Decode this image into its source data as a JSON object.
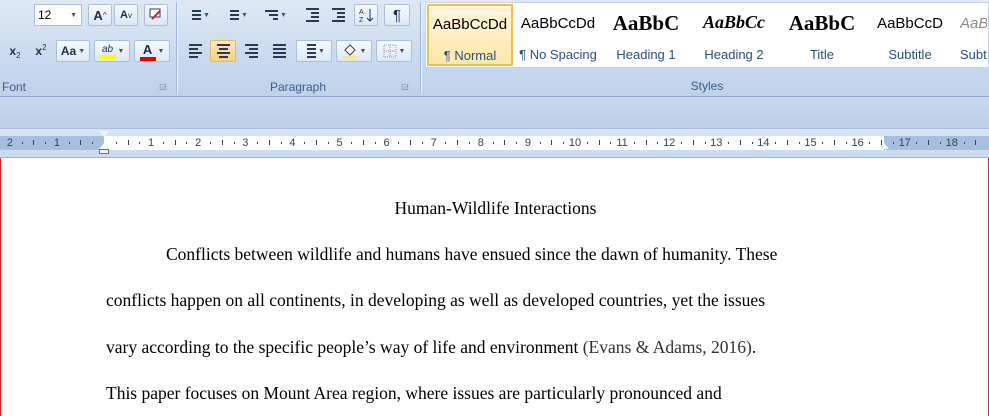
{
  "font_group": {
    "label": "Font",
    "font_size": "12",
    "grow_font": "A",
    "shrink_font": "A",
    "subscript": "x",
    "superscript": "x",
    "change_case": "Aa",
    "highlight_text": "ab",
    "font_color_letter": "A",
    "highlight_color": "#ffff00",
    "font_color": "#e00000"
  },
  "paragraph_group": {
    "label": "Paragraph",
    "show_marks": "¶"
  },
  "styles_group": {
    "label": "Styles",
    "items": [
      {
        "preview": "AaBbCcDd",
        "name": "¶ Normal"
      },
      {
        "preview": "AaBbCcDd",
        "name": "¶ No Spacing"
      },
      {
        "preview": "AaBbC",
        "name": "Heading 1"
      },
      {
        "preview": "AaBbCc",
        "name": "Heading 2"
      },
      {
        "preview": "AaBbC",
        "name": "Title"
      },
      {
        "preview": "AaBbCcD",
        "name": "Subtitle"
      },
      {
        "preview": "AaBbCcD",
        "name": "Subtl"
      }
    ]
  },
  "ruler": {
    "left_numbers": [
      "2",
      "1"
    ],
    "right_numbers": [
      "1",
      "2",
      "3",
      "4",
      "5",
      "6",
      "7",
      "8",
      "9",
      "10",
      "11",
      "12",
      "13",
      "14",
      "15",
      "16",
      "17",
      "18"
    ]
  },
  "document": {
    "title": "Human-Wildlife Interactions",
    "lines": [
      "Conflicts between wildlife and humans have ensued since the dawn of humanity. These",
      "conflicts happen on all continents, in developing as well as developed countries, yet the issues",
      "vary according to the specific people’s way of life and environment",
      "This paper focuses on Mount Area region, where issues are particularly pronounced and"
    ],
    "citation": "(Evans & Adams, 2016)",
    "citation_end": "."
  }
}
